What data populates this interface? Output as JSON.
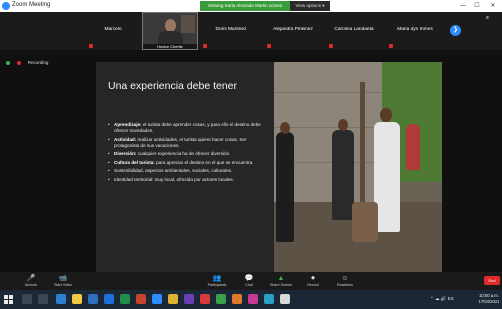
{
  "window": {
    "title": "Zoom Meeting",
    "share_banner": "Viewing Karla Alvarado Martin screen",
    "view_options": "View options ▾",
    "min": "—",
    "max": "☐",
    "close": "✕"
  },
  "participants": [
    {
      "name": "Marcelo",
      "muted": true
    },
    {
      "name": "Hector Cheritz",
      "muted": true,
      "video": true
    },
    {
      "name": "Doris Martinez",
      "muted": true
    },
    {
      "name": "Alejandra Pinkinez",
      "muted": true
    },
    {
      "name": "Carolina Landaeta",
      "muted": true
    },
    {
      "name": "Maria dyn Inmes",
      "muted": true
    }
  ],
  "strip_controls": {
    "next": "❯",
    "side": "≡"
  },
  "shared": {
    "host_label": "Recording"
  },
  "slide": {
    "title": "Una experiencia debe tener",
    "bullets": [
      {
        "term": "Aprendizaje:",
        "text": " el turista debe aprender cosas, y para ello el destino debe ofrecer novedades."
      },
      {
        "term": "Actividad:",
        "text": " realizar actividades, el turista quiere hacer cosas. Ser protagonista de sus vacaciones."
      },
      {
        "term": "Diversión:",
        "text": " cualquier experiencia ha de ofrecer diversión."
      },
      {
        "term": "Cultura del turista:",
        "text": " para apreciar el destino en el que se encuentra."
      },
      {
        "term": "",
        "text": "Sostenibilidad, aspectos ambientales, sociales, culturales."
      },
      {
        "term": "",
        "text": "Identidad territorial: muy local, ofrecida por actores locales."
      }
    ]
  },
  "toolbar": {
    "buttons": [
      {
        "name": "unmute",
        "icon": "🎤",
        "label": "Unmute"
      },
      {
        "name": "start-video",
        "icon": "📹",
        "label": "Start Video"
      },
      {
        "name": "participants",
        "icon": "👥",
        "label": "Participants"
      },
      {
        "name": "chat",
        "icon": "💬",
        "label": "Chat"
      },
      {
        "name": "share-screen",
        "icon": "▲",
        "label": "Share Screen"
      },
      {
        "name": "record",
        "icon": "⏺",
        "label": "Record"
      },
      {
        "name": "reactions",
        "icon": "☺",
        "label": "Reactions"
      }
    ],
    "end": "End"
  },
  "taskbar": {
    "tray": "⌃  ☁  🔊  ES",
    "time": "10:50 a.m.",
    "date": "17/04/2021"
  },
  "colors": {
    "accent": "#2d8cff",
    "share_green": "#3a9b3a",
    "end_red": "#e02b2b"
  }
}
